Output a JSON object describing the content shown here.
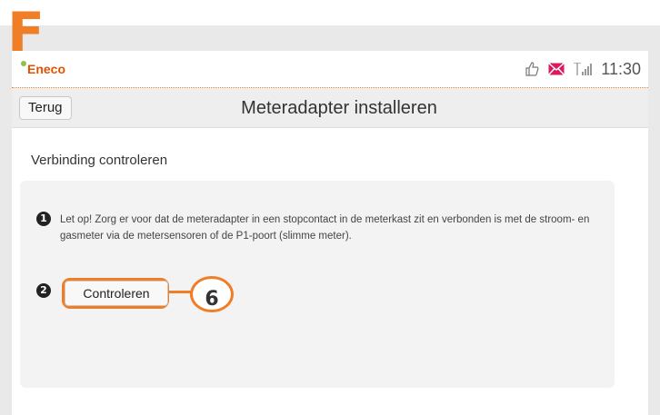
{
  "annotation": {
    "step_letter": "F",
    "callout_number": "6"
  },
  "status_bar": {
    "logo": "Eneco",
    "icons": [
      "thumbs-up-icon",
      "mail-icon",
      "signal-icon"
    ],
    "time": "11:30"
  },
  "nav": {
    "back_label": "Terug",
    "title": "Meteradapter installeren"
  },
  "content": {
    "section_heading": "Verbinding controleren",
    "steps": [
      {
        "number": "1",
        "text": "Let op! Zorg er voor dat de meteradapter in een stopcontact in de meterkast zit en verbonden is met de stroom- en gasmeter via de metersensoren of de P1-poort (slimme meter)."
      },
      {
        "number": "2",
        "button_label": "Controleren"
      }
    ]
  },
  "colors": {
    "accent": "#f07e26",
    "mail": "#d81b60"
  }
}
